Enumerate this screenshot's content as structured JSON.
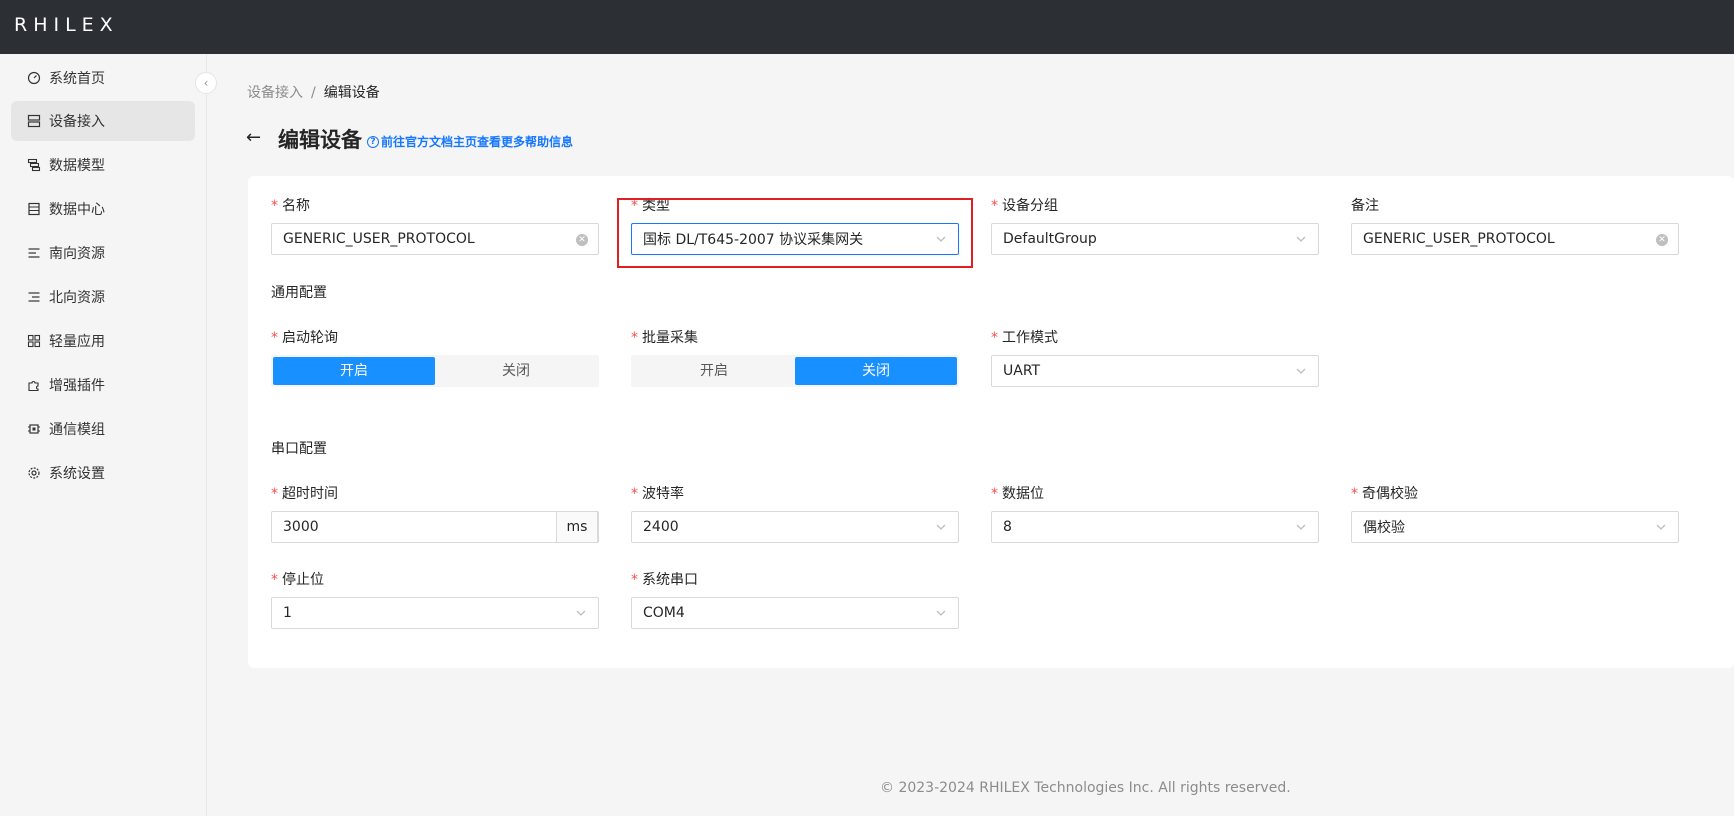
{
  "header": {
    "logo": "RHILEX"
  },
  "sidebar": {
    "items": [
      {
        "label": "系统首页",
        "icon": "dashboard-icon"
      },
      {
        "label": "设备接入",
        "icon": "device-icon",
        "active": true
      },
      {
        "label": "数据模型",
        "icon": "data-model-icon"
      },
      {
        "label": "数据中心",
        "icon": "data-center-icon"
      },
      {
        "label": "南向资源",
        "icon": "south-resource-icon"
      },
      {
        "label": "北向资源",
        "icon": "north-resource-icon"
      },
      {
        "label": "轻量应用",
        "icon": "apps-icon"
      },
      {
        "label": "增强插件",
        "icon": "plugin-icon"
      },
      {
        "label": "通信模组",
        "icon": "chip-icon"
      },
      {
        "label": "系统设置",
        "icon": "gear-icon"
      }
    ]
  },
  "breadcrumb": {
    "parent": "设备接入",
    "separator": "/",
    "current": "编辑设备"
  },
  "page": {
    "title": "编辑设备",
    "help_text": "前往官方文档主页查看更多帮助信息"
  },
  "form": {
    "name": {
      "label": "名称",
      "value": "GENERIC_USER_PROTOCOL"
    },
    "type": {
      "label": "类型",
      "value": "国标 DL/T645-2007 协议采集网关"
    },
    "group": {
      "label": "设备分组",
      "value": "DefaultGroup"
    },
    "remark": {
      "label": "备注",
      "value": "GENERIC_USER_PROTOCOL"
    },
    "general_section": "通用配置",
    "auto_poll": {
      "label": "启动轮询",
      "on": "开启",
      "off": "关闭",
      "selected": "开启"
    },
    "batch": {
      "label": "批量采集",
      "on": "开启",
      "off": "关闭",
      "selected": "关闭"
    },
    "work_mode": {
      "label": "工作模式",
      "value": "UART"
    },
    "serial_section": "串口配置",
    "timeout": {
      "label": "超时时间",
      "value": "3000",
      "unit": "ms"
    },
    "baud": {
      "label": "波特率",
      "value": "2400"
    },
    "data_bits": {
      "label": "数据位",
      "value": "8"
    },
    "parity": {
      "label": "奇偶校验",
      "value": "偶校验"
    },
    "stop_bits": {
      "label": "停止位",
      "value": "1"
    },
    "port": {
      "label": "系统串口",
      "value": "COM4"
    }
  },
  "footer": {
    "text": "© 2023-2024 RHILEX Technologies Inc. All rights reserved."
  }
}
